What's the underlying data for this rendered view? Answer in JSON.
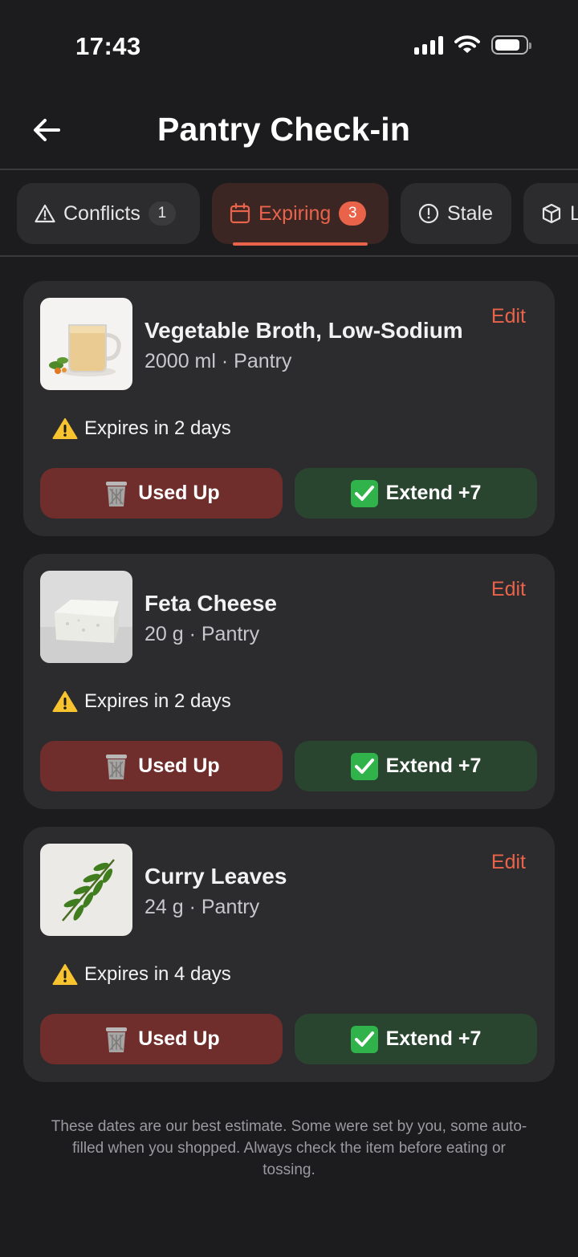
{
  "status_bar": {
    "time": "17:43"
  },
  "header": {
    "title": "Pantry Check-in",
    "back_icon": "arrow-left-icon"
  },
  "tabs": [
    {
      "label": "Conflicts",
      "badge": "1",
      "icon": "warning-triangle-icon",
      "active": false
    },
    {
      "label": "Expiring",
      "badge": "3",
      "icon": "calendar-icon",
      "active": true
    },
    {
      "label": "Stale",
      "badge": "",
      "icon": "alert-circle-icon",
      "active": false
    },
    {
      "label": "L",
      "badge": "",
      "icon": "box-icon",
      "active": false
    }
  ],
  "items": [
    {
      "name": "Vegetable Broth, Low-Sodium",
      "detail": "2000 ml · Pantry",
      "edit": "Edit",
      "expiry": "Expires in 2 days",
      "used_label": "Used Up",
      "extend_label": "Extend +7",
      "thumb": "broth-mug"
    },
    {
      "name": "Feta Cheese",
      "detail": "20 g · Pantry",
      "edit": "Edit",
      "expiry": "Expires in 2 days",
      "used_label": "Used Up",
      "extend_label": "Extend +7",
      "thumb": "feta-block"
    },
    {
      "name": "Curry Leaves",
      "detail": "24 g · Pantry",
      "edit": "Edit",
      "expiry": "Expires in 4 days",
      "used_label": "Used Up",
      "extend_label": "Extend +7",
      "thumb": "curry-leaf"
    }
  ],
  "footnote": "These dates are our best estimate. Some were set by you, some auto-filled when you shopped. Always check the item before eating or tossing.",
  "colors": {
    "accent": "#e8634a",
    "background": "#1c1c1e",
    "card": "#2c2c2e",
    "used_bg": "#6f2e2c",
    "extend_bg": "#29452f"
  }
}
